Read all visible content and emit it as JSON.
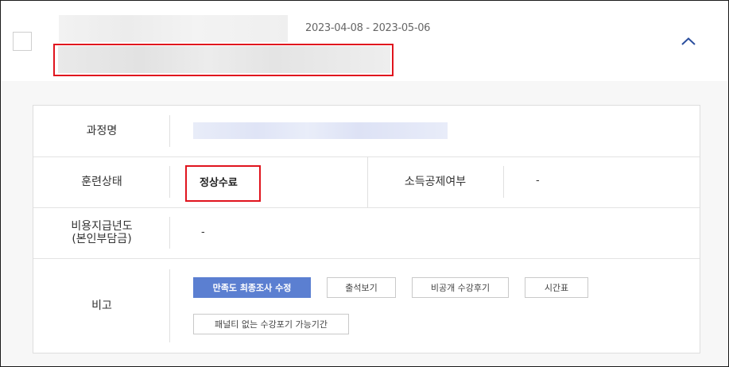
{
  "course": {
    "date_range": "2023-04-08 - 2023-05-06"
  },
  "details": {
    "course_name_label": "과정명",
    "training_status_label": "훈련상태",
    "training_status_value": "정상수료",
    "tax_deduction_label": "소득공제여부",
    "tax_deduction_value": "-",
    "payment_year_label_line1": "비용지급년도",
    "payment_year_label_line2": "(본인부담금)",
    "payment_year_value": "-",
    "remarks_label": "비고"
  },
  "buttons": {
    "survey_edit": "만족도 최종조사 수정",
    "attendance": "출석보기",
    "private_review": "비공개 수강후기",
    "timetable": "시간표",
    "penalty_free_cancel": "패널티 없는 수강포기 가능기간"
  },
  "colors": {
    "highlight_border": "#e0141e",
    "primary_button": "#5b7fd1",
    "collapse_icon": "#2b4f9e"
  },
  "icons": {
    "collapse": "chevron-up-icon"
  }
}
